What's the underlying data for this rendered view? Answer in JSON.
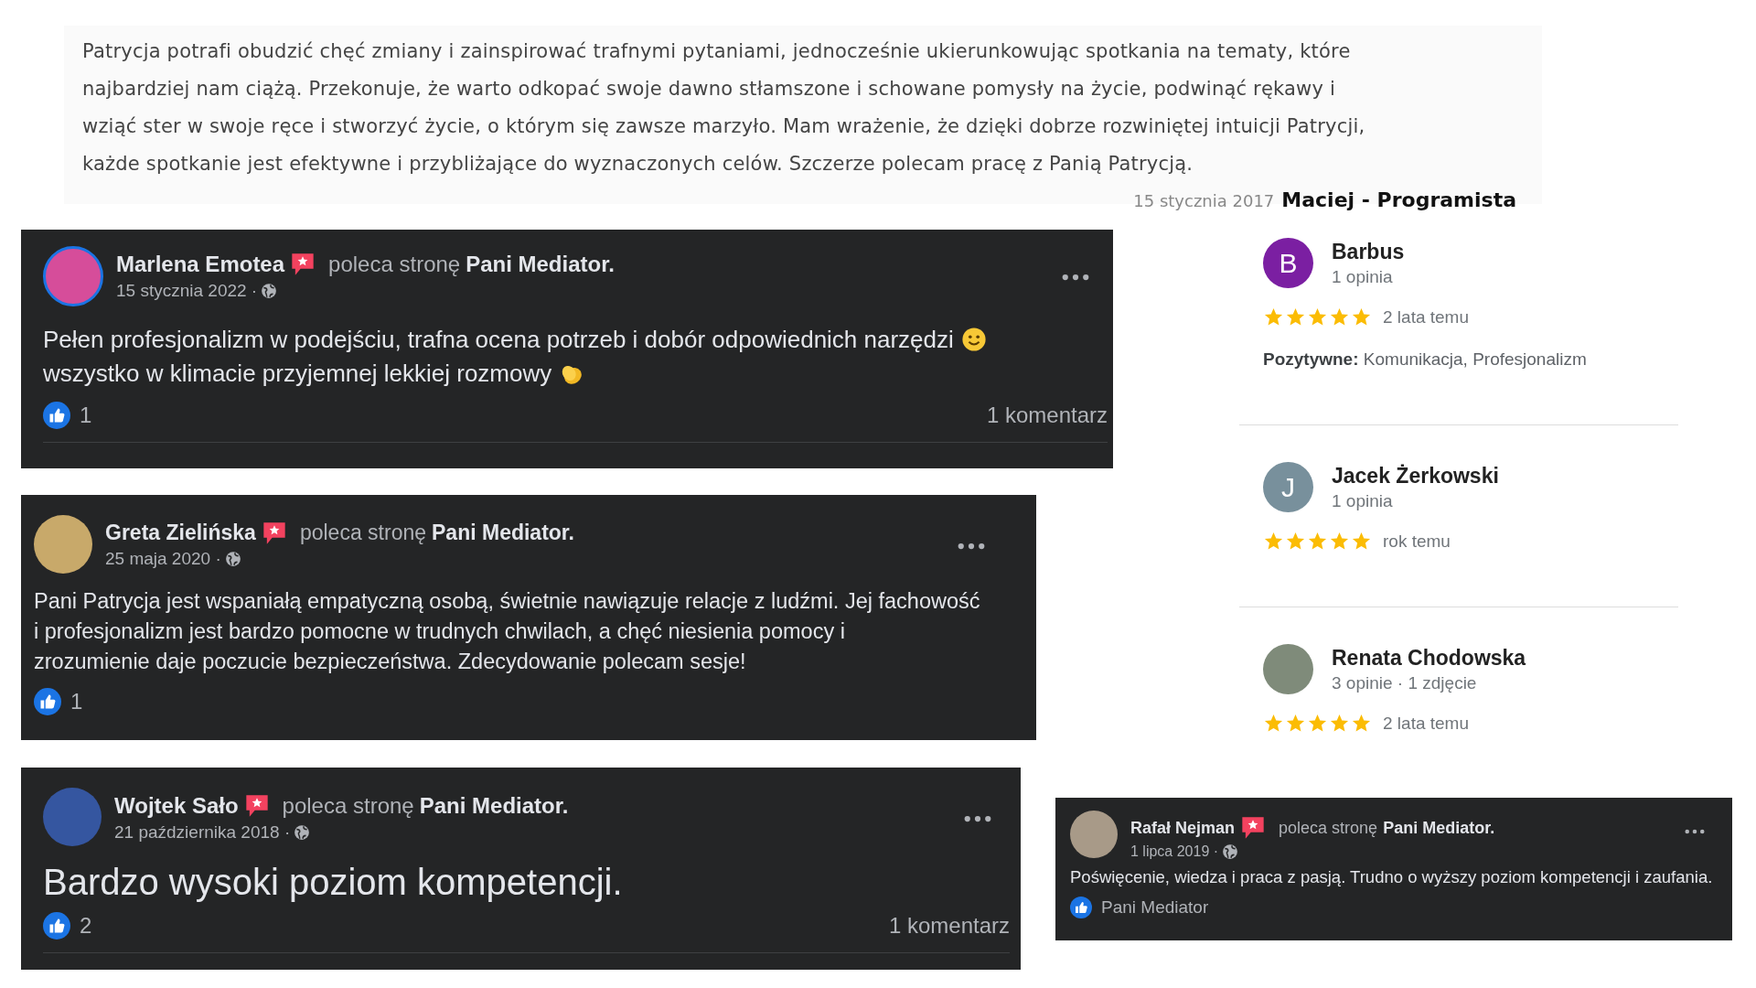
{
  "testimonial": {
    "lines": [
      "Patrycja potrafi obudzić chęć zmiany i zainspirować trafnymi pytaniami, jednocześnie ukierunkowując spotkania na tematy, które",
      "najbardziej nam ciążą. Przekonuje, że warto odkopać swoje dawno stłamszone i schowane pomysły na życie, podwinąć rękawy i",
      "wziąć ster w swoje ręce i stworzyć życie, o którym się zawsze marzyło. Mam wrażenie, że dzięki dobrze rozwiniętej intuicji Patrycji,",
      "każde spotkanie jest efektywne i przybliżające do wyznaczonych celów. Szczerze polecam pracę z Panią Patrycją."
    ],
    "date": "15 stycznia 2017",
    "author": "Maciej - Programista"
  },
  "facebook_posts": [
    {
      "author": "Marlena Emotea",
      "action": "poleca stronę",
      "page": "Pani Mediator.",
      "date": "15 stycznia 2022 ·",
      "body": [
        {
          "text": "Pełen profesjonalizm w podejściu, trafna ocena potrzeb i dobór odpowiednich narzędzi",
          "kind": "smiley"
        },
        {
          "text": "wszystko w klimacie przyjemnej  lekkiej rozmowy",
          "kind": "clap"
        }
      ],
      "likes": "1",
      "comments": "1 komentarz"
    },
    {
      "author": "Greta Zielińska",
      "action": "poleca stronę",
      "page": "Pani Mediator.",
      "date": "25 maja 2020 ·",
      "body": [
        {
          "text": "Pani Patrycja jest wspaniałą empatyczną osobą, świetnie nawiązuje relacje z ludźmi. Jej fachowość"
        },
        {
          "text": "i profesjonalizm jest bardzo pomocne w trudnych chwilach, a chęć niesienia pomocy i"
        },
        {
          "text": "zrozumienie daje poczucie bezpieczeństwa. Zdecydowanie polecam sesje!"
        }
      ],
      "likes": "1"
    },
    {
      "author": "Wojtek Sało",
      "action": "poleca stronę",
      "page": "Pani Mediator.",
      "date": "21 października 2018 ·",
      "body": [
        {
          "text": "Bardzo wysoki poziom kompetencji."
        }
      ],
      "likes": "2",
      "comments": "1 komentarz"
    },
    {
      "author": "Rafał Nejman",
      "action": "poleca stronę",
      "page": "Pani Mediator.",
      "date": "1 lipca 2019 ·",
      "body": [
        {
          "text": "Poświęcenie, wiedza i praca z pasją. Trudno o wyższy poziom kompetencji i zaufania."
        }
      ],
      "likes": "Pani Mediator"
    }
  ],
  "google_reviews": [
    {
      "name": "Barbus",
      "meta": "1 opinia",
      "avatar_letter": "B",
      "color": "#7b1fa2",
      "stars": 5,
      "time": "2 lata temu",
      "positive_label": "Pozytywne:",
      "positive": "Komunikacja, Profesjonalizm"
    },
    {
      "name": "Jacek Żerkowski",
      "meta": "1 opinia",
      "avatar_letter": "J",
      "color": "#78909c",
      "stars": 5,
      "time": "rok temu"
    },
    {
      "name": "Renata Chodowska",
      "meta": "3 opinie · 1 zdjęcie",
      "stars": 5,
      "time": "2 lata temu"
    }
  ]
}
